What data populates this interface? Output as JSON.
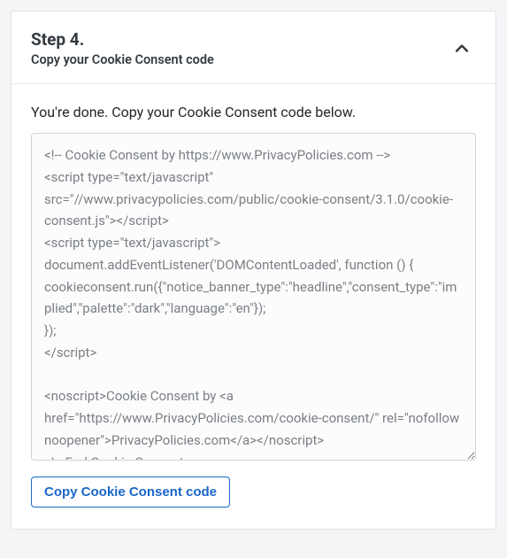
{
  "header": {
    "step_label": "Step 4.",
    "subtitle": "Copy your Cookie Consent code"
  },
  "body": {
    "instruction": "You're done. Copy your Cookie Consent code below.",
    "code": "<!-- Cookie Consent by https://www.PrivacyPolicies.com -->\n<script type=\"text/javascript\" src=\"//www.privacypolicies.com/public/cookie-consent/3.1.0/cookie-consent.js\"></script>\n<script type=\"text/javascript\">\ndocument.addEventListener('DOMContentLoaded', function () {\ncookieconsent.run({\"notice_banner_type\":\"headline\",\"consent_type\":\"implied\",\"palette\":\"dark\",\"language\":\"en\"});\n});\n</script>\n\n<noscript>Cookie Consent by <a href=\"https://www.PrivacyPolicies.com/cookie-consent/\" rel=\"nofollow noopener\">PrivacyPolicies.com</a></noscript>\n<!-- End Cookie Consent -->",
    "copy_button_label": "Copy Cookie Consent code"
  }
}
